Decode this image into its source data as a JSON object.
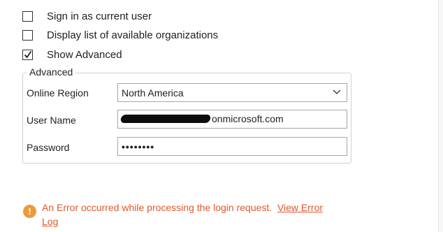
{
  "options": {
    "sign_in_current_user": {
      "label": "Sign in as current user",
      "checked": false
    },
    "display_orgs": {
      "label": "Display list of available organizations",
      "checked": false
    },
    "show_advanced": {
      "label": "Show Advanced",
      "checked": true
    }
  },
  "advanced": {
    "legend": "Advanced",
    "online_region": {
      "label": "Online Region",
      "value": "North America"
    },
    "user_name": {
      "label": "User Name",
      "visible_suffix": "onmicrosoft.com"
    },
    "password": {
      "label": "Password",
      "value": "••••••••"
    }
  },
  "error": {
    "message": "An Error occurred while processing the login request.",
    "link_text_line1": "View Error",
    "link_text_line2": "Log",
    "color": "#e0582d",
    "icon_color": "#ec9a3b"
  }
}
